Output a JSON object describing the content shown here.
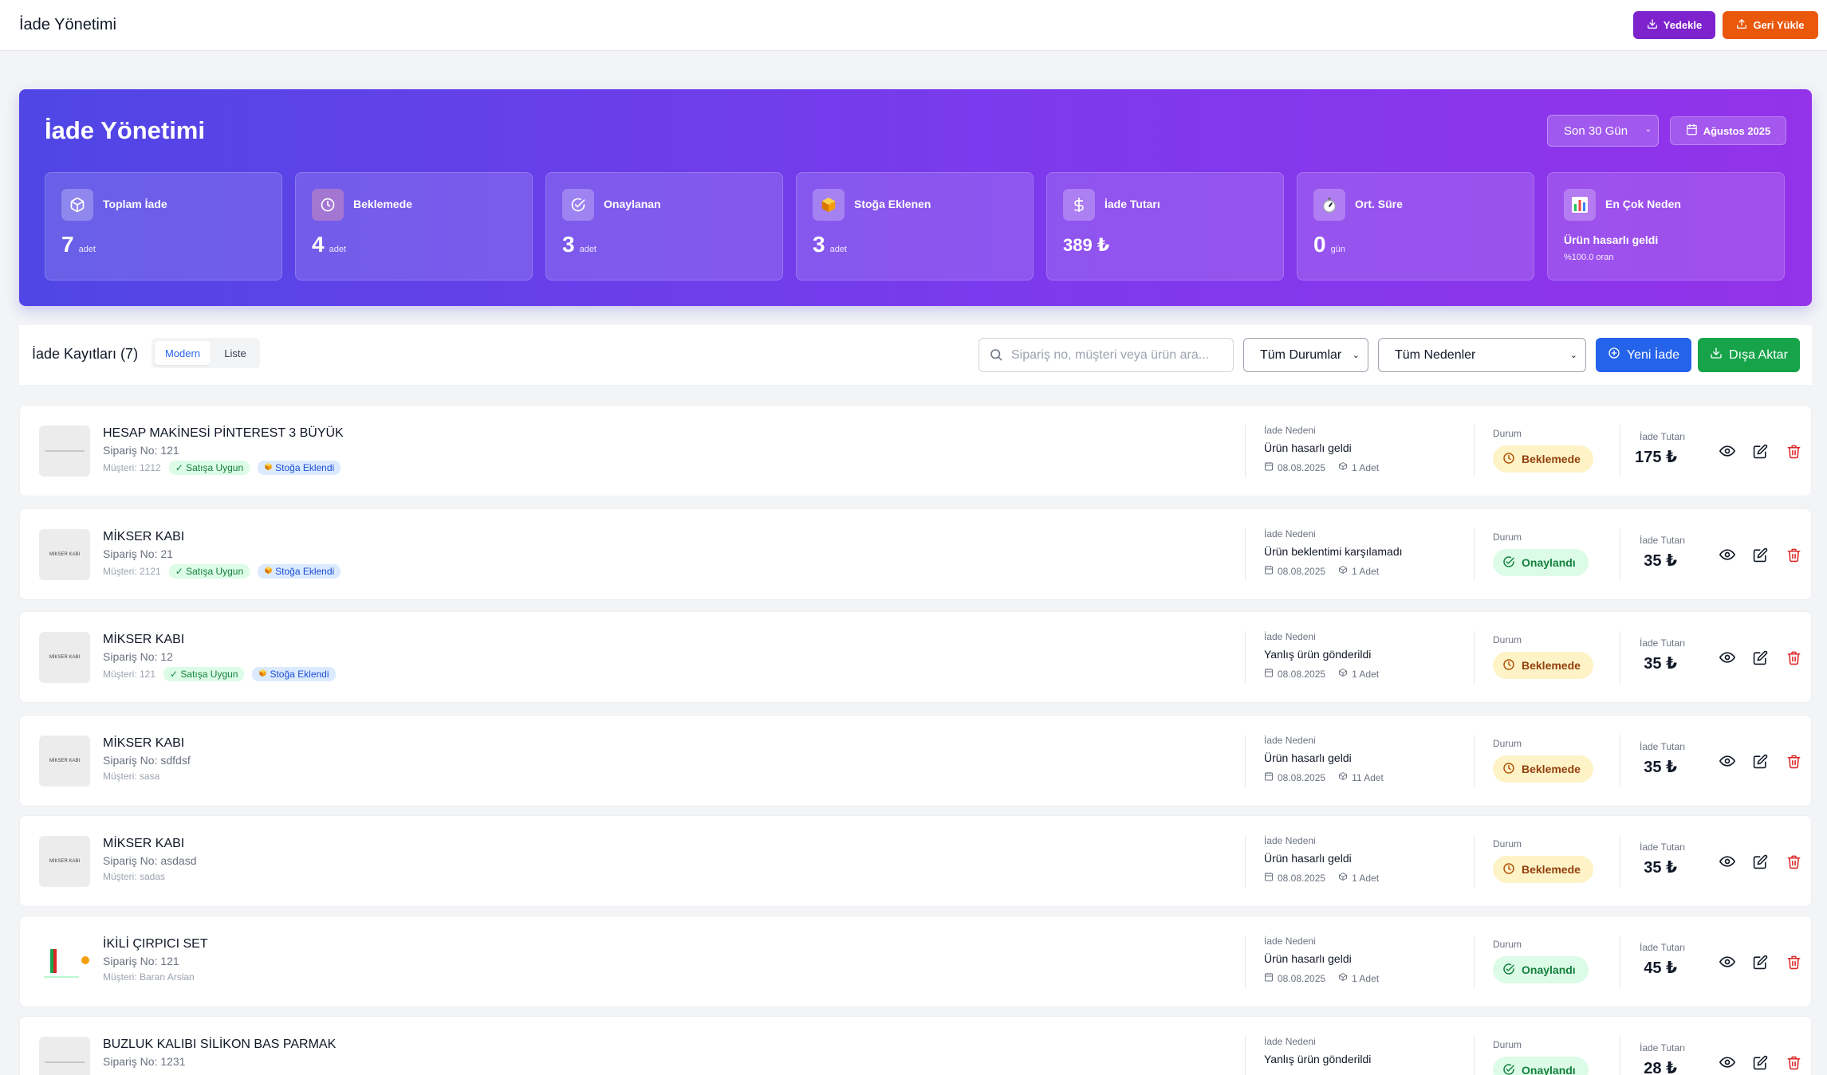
{
  "header": {
    "title": "İade Yönetimi",
    "backup_label": "Yedekle",
    "restore_label": "Geri Yükle"
  },
  "hero": {
    "title": "İade Yönetimi",
    "period": "Son 30 Gün",
    "month_label": "Ağustos 2025",
    "stats": [
      {
        "label": "Toplam İade",
        "value": "7",
        "unit": "adet",
        "icon": "package-icon"
      },
      {
        "label": "Beklemede",
        "value": "4",
        "unit": "adet",
        "icon": "clock-icon"
      },
      {
        "label": "Onaylanan",
        "value": "3",
        "unit": "adet",
        "icon": "check-circle-icon"
      },
      {
        "label": "Stoğa Eklenen",
        "value": "3",
        "unit": "adet",
        "icon": "box-icon"
      },
      {
        "label": "İade Tutarı",
        "value": "389 ₺",
        "unit": "",
        "icon": "dollar-icon"
      },
      {
        "label": "Ort. Süre",
        "value": "0",
        "unit": "gün",
        "icon": "stopwatch-icon"
      },
      {
        "label": "En Çok Neden",
        "reason": "Ürün hasarlı geldi",
        "ratio": "%100.0 oran",
        "icon": "bar-chart-icon"
      }
    ]
  },
  "toolbar": {
    "title": "İade Kayıtları (7)",
    "view_modern": "Modern",
    "view_list": "Liste",
    "search_placeholder": "Sipariş no, müşteri veya ürün ara...",
    "status_filter": "Tüm Durumlar",
    "reason_filter": "Tüm Nedenler",
    "new_label": "Yeni İade",
    "export_label": "Dışa Aktar"
  },
  "labels": {
    "reason": "İade Nedeni",
    "status": "Durum",
    "amount": "İade Tutarı"
  },
  "colors": {
    "accent": "#2563eb",
    "hero_start": "#4f46e5",
    "hero_end": "#9333ea",
    "pending_bg": "#fef3c7",
    "approved_bg": "#dcfce7",
    "delete": "#dc2626"
  },
  "returns": [
    {
      "name": "HESAP MAKİNESİ PİNTEREST 3 BÜYÜK",
      "order": "Sipariş No: 121",
      "customer": "Müşteri: 1212",
      "tag_sale": "✓ Satışa Uygun",
      "tag_stock": "Stoğa Eklendi",
      "reason": "Ürün hasarlı geldi",
      "date": "08.08.2025",
      "qty": "1 Adet",
      "status": "Beklemede",
      "status_type": "pending",
      "amount": "175 ₺",
      "thumb_text": ""
    },
    {
      "name": "MİKSER KABI",
      "order": "Sipariş No: 21",
      "customer": "Müşteri: 2121",
      "tag_sale": "✓ Satışa Uygun",
      "tag_stock": "Stoğa Eklendi",
      "reason": "Ürün beklentimi karşılamadı",
      "date": "08.08.2025",
      "qty": "1 Adet",
      "status": "Onaylandı",
      "status_type": "approved",
      "amount": "35 ₺",
      "thumb_text": "MİKSER KABI"
    },
    {
      "name": "MİKSER KABI",
      "order": "Sipariş No: 12",
      "customer": "Müşteri: 121",
      "tag_sale": "✓ Satışa Uygun",
      "tag_stock": "Stoğa Eklendi",
      "reason": "Yanlış ürün gönderildi",
      "date": "08.08.2025",
      "qty": "1 Adet",
      "status": "Beklemede",
      "status_type": "pending",
      "amount": "35 ₺",
      "thumb_text": "MİKSER KABI"
    },
    {
      "name": "MİKSER KABI",
      "order": "Sipariş No: sdfdsf",
      "customer": "Müşteri: sasa",
      "tag_sale": "",
      "tag_stock": "",
      "reason": "Ürün hasarlı geldi",
      "date": "08.08.2025",
      "qty": "11 Adet",
      "status": "Beklemede",
      "status_type": "pending",
      "amount": "35 ₺",
      "thumb_text": "MİKSER KABI"
    },
    {
      "name": "MİKSER KABI",
      "order": "Sipariş No: asdasd",
      "customer": "Müşteri: sadas",
      "tag_sale": "",
      "tag_stock": "",
      "reason": "Ürün hasarlı geldi",
      "date": "08.08.2025",
      "qty": "1 Adet",
      "status": "Beklemede",
      "status_type": "pending",
      "amount": "35 ₺",
      "thumb_text": "MİKSER KABI"
    },
    {
      "name": "İKİLİ ÇIRPICI SET",
      "order": "Sipariş No: 121",
      "customer": "Müşteri: Baran Arslan",
      "tag_sale": "",
      "tag_stock": "",
      "reason": "Ürün hasarlı geldi",
      "date": "08.08.2025",
      "qty": "1 Adet",
      "status": "Onaylandı",
      "status_type": "approved",
      "amount": "45 ₺",
      "thumb_text": ""
    },
    {
      "name": "BUZLUK KALIBI SİLİKON BAS PARMAK",
      "order": "Sipariş No: 1231",
      "customer": "",
      "tag_sale": "",
      "tag_stock": "",
      "reason": "Yanlış ürün gönderildi",
      "date": "",
      "qty": "",
      "status": "Onaylandı",
      "status_type": "approved",
      "amount": "28 ₺",
      "thumb_text": ""
    }
  ]
}
